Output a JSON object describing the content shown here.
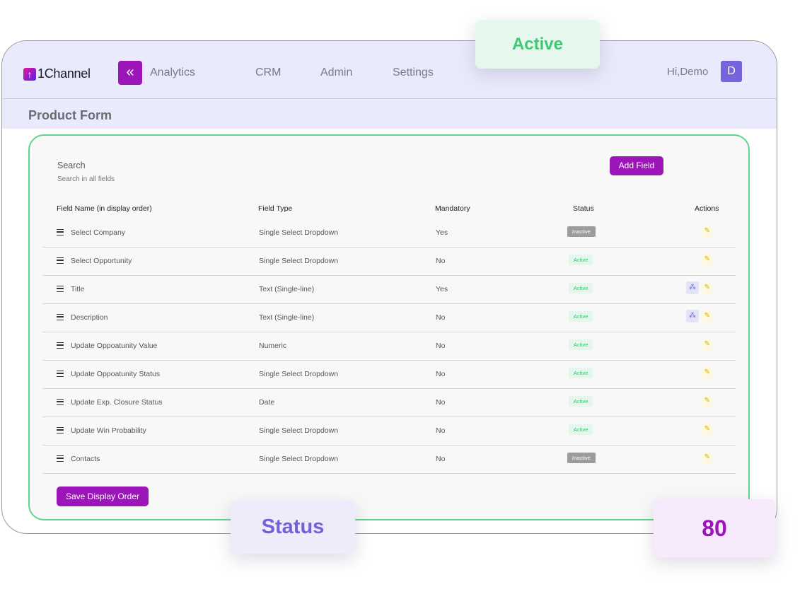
{
  "header": {
    "logo_mark": "↑",
    "logo_text": "1Channel",
    "collapse_icon": "«",
    "nav": [
      "Analytics",
      "CRM",
      "Admin",
      "Settings"
    ],
    "greeting": "Hi,Demo",
    "avatar_letter": "D"
  },
  "page": {
    "title": "Product Form"
  },
  "search": {
    "label": "Search",
    "hint": "Search in all fields"
  },
  "buttons": {
    "add_field": "Add Field",
    "save_display_order": "Save Display Order"
  },
  "table": {
    "headers": [
      "Field Name (in display order)",
      "Field Type",
      "Mandatory",
      "Status",
      "Actions"
    ],
    "rows": [
      {
        "name": "Select Company",
        "type": "Single Select Dropdown",
        "mandatory": "Yes",
        "status": "Inactive",
        "options_action": false
      },
      {
        "name": "Select Opportunity",
        "type": "Single Select Dropdown",
        "mandatory": "No",
        "status": "Active",
        "options_action": false
      },
      {
        "name": "Title",
        "type": "Text (Single-line)",
        "mandatory": "Yes",
        "status": "Active",
        "options_action": true
      },
      {
        "name": "Description",
        "type": "Text (Single-line)",
        "mandatory": "No",
        "status": "Active",
        "options_action": true
      },
      {
        "name": "Update Oppoatunity Value",
        "type": "Numeric",
        "mandatory": "No",
        "status": "Active",
        "options_action": false
      },
      {
        "name": "Update Oppoatunity Status",
        "type": "Single Select Dropdown",
        "mandatory": "No",
        "status": "Active",
        "options_action": false
      },
      {
        "name": "Update Exp. Closure Status",
        "type": "Date",
        "mandatory": "No",
        "status": "Active",
        "options_action": false
      },
      {
        "name": "Update Win Probability",
        "type": "Single Select Dropdown",
        "mandatory": "No",
        "status": "Active",
        "options_action": false
      },
      {
        "name": "Contacts",
        "type": "Single Select Dropdown",
        "mandatory": "No",
        "status": "Inactive",
        "options_action": false
      }
    ]
  },
  "icons": {
    "edit": "pencil-icon",
    "options": "options-icon",
    "drag": "drag-handle-icon"
  },
  "floating_cards": {
    "active": "Active",
    "status": "Status",
    "value": "80"
  },
  "colors": {
    "accent": "#9b15b8",
    "active_green": "#33c36a",
    "inactive_gray": "#9c9c9c",
    "header_bg": "#e9eafb"
  }
}
